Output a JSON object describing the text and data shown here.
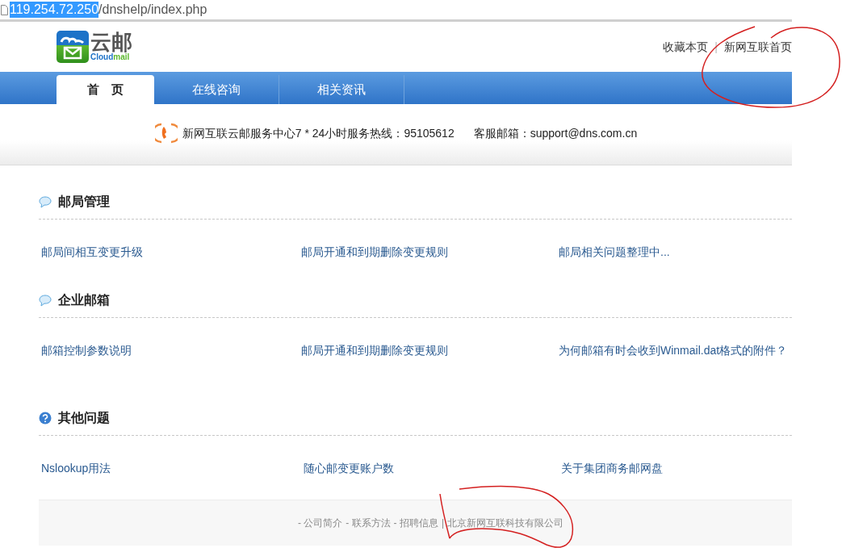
{
  "address_bar": {
    "url_selected": "119.254.72.250",
    "url_rest": "/dnshelp/index.php"
  },
  "header": {
    "logo_text": "云邮",
    "logo_subtext_a": "Cloud",
    "logo_subtext_b": "mail",
    "links": [
      "收藏本页",
      "新网互联首页"
    ],
    "separator": "|"
  },
  "nav": [
    {
      "label": "首　页",
      "selected": true
    },
    {
      "label": "在线咨询",
      "selected": false
    },
    {
      "label": "相关资讯",
      "selected": false
    }
  ],
  "info": {
    "hotline": "新网互联云邮服务中心7 * 24小时服务热线：95105612",
    "email": "客服邮箱：support@dns.com.cn"
  },
  "sections": [
    {
      "title": "邮局管理",
      "kind": "comment",
      "links": [
        "邮局间相互变更升级",
        "邮局开通和到期删除变更规则",
        "邮局相关问题整理中..."
      ]
    },
    {
      "title": "企业邮箱",
      "kind": "comment",
      "links": [
        "邮箱控制参数说明",
        "邮局开通和到期删除变更规则",
        "为何邮箱有时会收到Winmail.dat格式的附件？"
      ]
    },
    {
      "title": "其他问题",
      "kind": "help",
      "links": [
        "Nslookup用法",
        "随心邮变更账户数",
        "关于集团商务邮网盘"
      ]
    }
  ],
  "footer": {
    "links": [
      "- 公司简介",
      "- 联系方法",
      "- 招聘信息"
    ],
    "separator": "|",
    "company": "北京新网互联科技有限公司"
  }
}
